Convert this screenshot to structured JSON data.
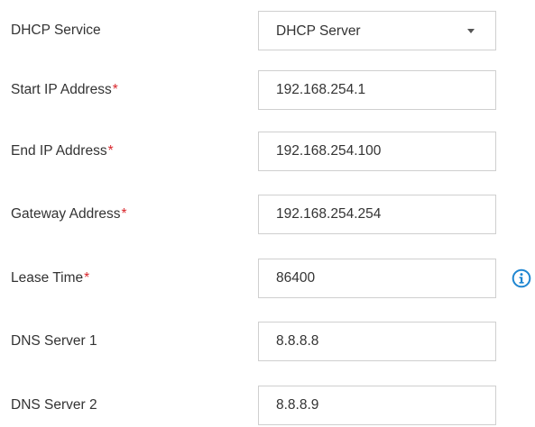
{
  "colors": {
    "required_marker": "#d9262c",
    "info_icon": "#1f86d1",
    "field_border": "#cfcfcf",
    "text": "#333333"
  },
  "form": {
    "dhcp_service": {
      "label": "DHCP Service",
      "selected": "DHCP Server",
      "icon": "chevron-down-icon"
    },
    "start_ip": {
      "label": "Start IP Address",
      "required": "*",
      "value": "192.168.254.1"
    },
    "end_ip": {
      "label": "End IP Address",
      "required": "*",
      "value": "192.168.254.100"
    },
    "gateway": {
      "label": "Gateway Address",
      "required": "*",
      "value": "192.168.254.254"
    },
    "lease_time": {
      "label": "Lease Time",
      "required": "*",
      "value": "86400",
      "icon": "info-icon"
    },
    "dns1": {
      "label": "DNS Server 1",
      "value": "8.8.8.8"
    },
    "dns2": {
      "label": "DNS Server 2",
      "value": "8.8.8.9"
    }
  }
}
